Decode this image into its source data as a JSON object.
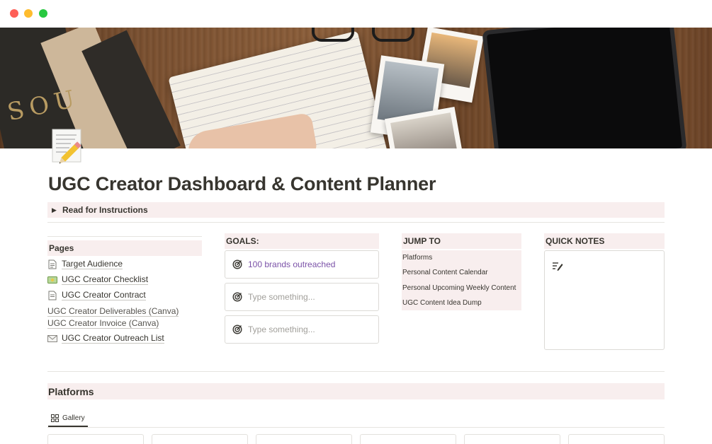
{
  "window": {
    "controls": [
      "close",
      "minimize",
      "zoom"
    ]
  },
  "cover": {
    "image_description_icon": "desk-cover-image",
    "book_spine_text": "SOU"
  },
  "page": {
    "icon": "memo-pencil-icon",
    "title": "UGC Creator Dashboard & Content Planner"
  },
  "toggle": {
    "label": "Read for Instructions",
    "expanded": false
  },
  "pages_section": {
    "header": "Pages",
    "items": [
      {
        "label": "Target Audience",
        "icon": "document-icon"
      },
      {
        "label": "UGC Creator Checklist",
        "icon": "money-icon"
      },
      {
        "label": "UGC Creator Contract",
        "icon": "document-icon"
      },
      {
        "label": "UGC Creator Deliverables (Canva)",
        "icon": ""
      },
      {
        "label": "UGC Creator Invoice (Canva)",
        "icon": ""
      },
      {
        "label": "UGC Creator Outreach List",
        "icon": "envelope-icon"
      }
    ]
  },
  "goals_section": {
    "header": "GOALS:",
    "items": [
      {
        "text": "100 brands outreached",
        "icon": "target-icon",
        "filled": true
      },
      {
        "text": "Type something...",
        "icon": "target-icon",
        "filled": false
      },
      {
        "text": "Type something...",
        "icon": "target-icon",
        "filled": false
      }
    ]
  },
  "jump_section": {
    "header": "JUMP TO",
    "items": [
      "Platforms",
      "Personal Content Calendar",
      "Personal Upcoming Weekly Content",
      "UGC Content Idea Dump"
    ]
  },
  "notes_section": {
    "header": "QUICK NOTES",
    "icon": "edit-lines-icon"
  },
  "platforms": {
    "header": "Platforms",
    "view_tab": "Gallery",
    "view_icon": "gallery-grid-icon"
  },
  "colors": {
    "header_bg": "#f8eeee",
    "goal_filled_text": "#7b52a8",
    "placeholder_text": "#a19f9a",
    "text": "#37352f"
  }
}
